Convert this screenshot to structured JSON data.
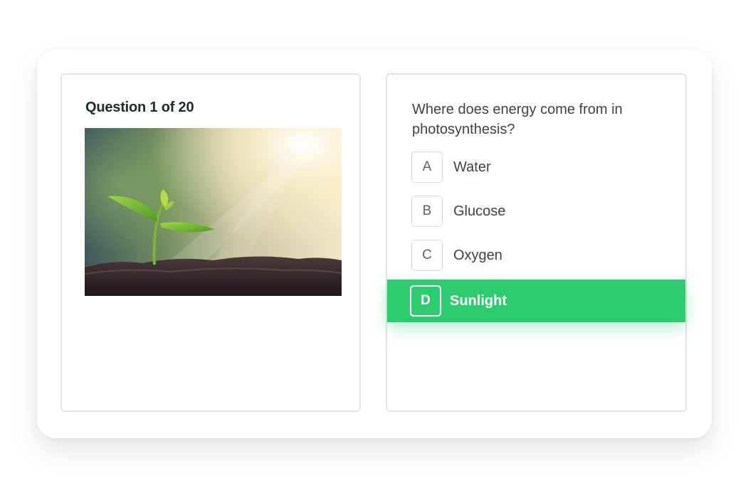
{
  "question": {
    "counter": "Question 1 of 20",
    "text": "Where does energy come from in photosynthesis?",
    "image": "plant-sprout-in-sunlight-image"
  },
  "options": [
    {
      "letter": "A",
      "label": "Water",
      "selected": false
    },
    {
      "letter": "B",
      "label": "Glucose",
      "selected": false
    },
    {
      "letter": "C",
      "label": "Oxygen",
      "selected": false
    },
    {
      "letter": "D",
      "label": "Sunlight",
      "selected": true
    }
  ],
  "colors": {
    "selected": "#2ecc71",
    "text": "#3e4446",
    "title": "#1c2b2b",
    "border": "#e3e3e3"
  }
}
